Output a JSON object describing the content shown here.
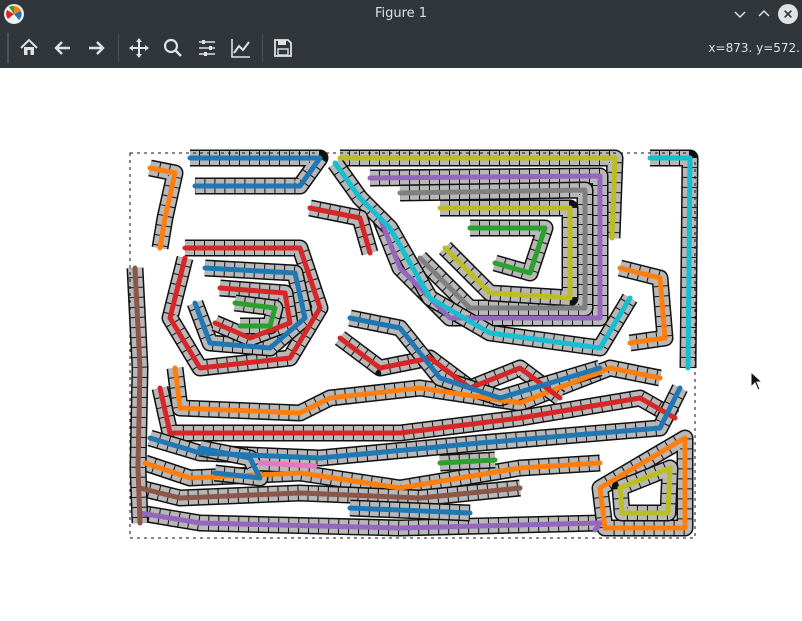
{
  "window": {
    "title": "Figure 1",
    "controls": [
      "minimize",
      "maximize",
      "close"
    ]
  },
  "toolbar": {
    "tools": [
      {
        "name": "home",
        "icon": "home-icon"
      },
      {
        "name": "back",
        "icon": "back-arrow-icon"
      },
      {
        "name": "forward",
        "icon": "forward-arrow-icon"
      },
      {
        "name": "pan",
        "icon": "move-icon"
      },
      {
        "name": "zoom",
        "icon": "zoom-icon"
      },
      {
        "name": "configure-subplots",
        "icon": "sliders-icon"
      },
      {
        "name": "edit-axes",
        "icon": "chart-line-icon"
      },
      {
        "name": "save",
        "icon": "save-icon"
      }
    ],
    "coordinates": "x=873. y=572."
  },
  "figure": {
    "description_colors": [
      "#1f77b4",
      "#ff7f0e",
      "#2ca02c",
      "#d62728",
      "#9467bd",
      "#8c564b",
      "#e377c2",
      "#7f7f7f",
      "#bcbd22",
      "#17becf"
    ]
  },
  "colors": {
    "titlebar": "#31363b",
    "toolbar": "#31363b",
    "icon": "#dfe1e3"
  }
}
